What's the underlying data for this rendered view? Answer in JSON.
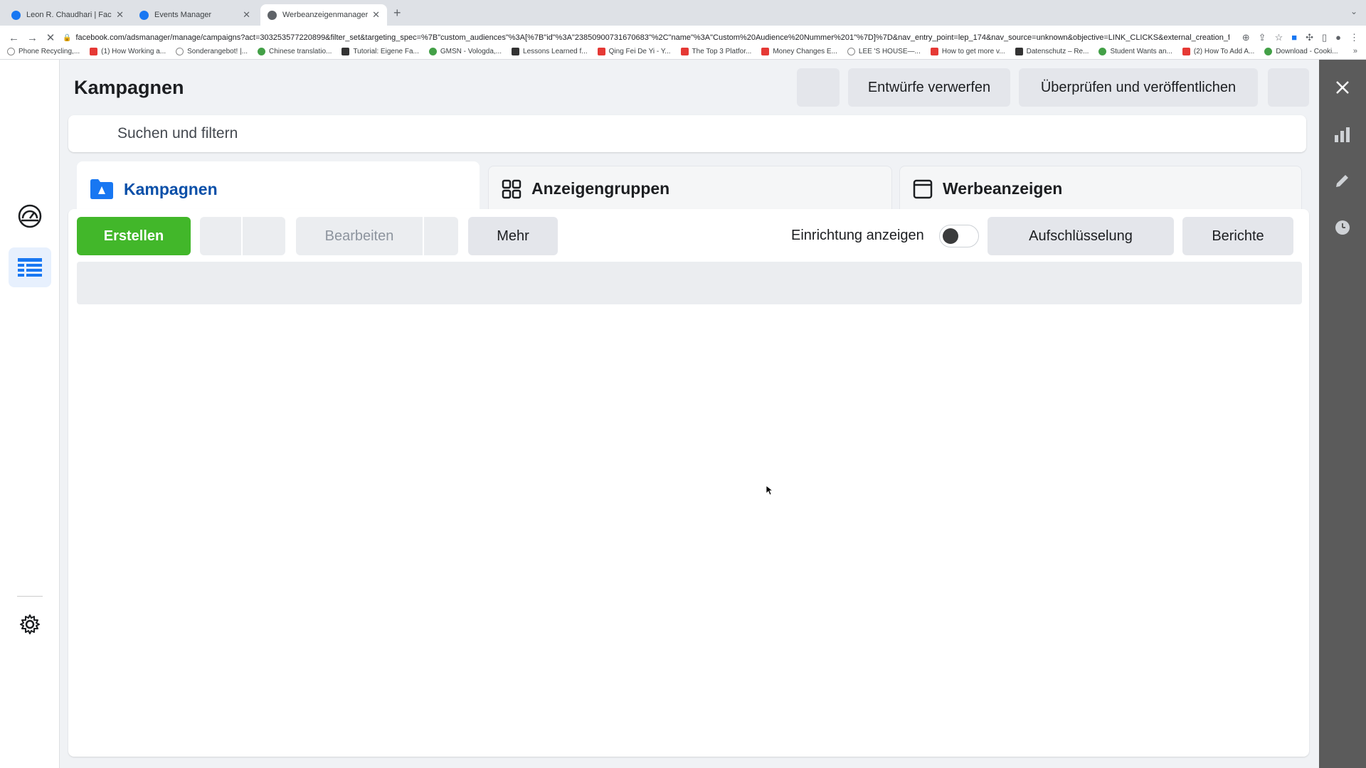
{
  "browser": {
    "tabs": [
      {
        "label": "Leon R. Chaudhari | Facebook",
        "active": false
      },
      {
        "label": "Events Manager",
        "active": false
      },
      {
        "label": "Werbeanzeigenmanager - Wer",
        "active": true
      }
    ],
    "url": "facebook.com/adsmanager/manage/campaigns?act=303253577220899&filter_set&targeting_spec=%7B\"custom_audiences\"%3A[%7B\"id\"%3A\"23850900731670683\"%2C\"name\"%3A\"Custom%20Audience%20Nummer%201\"%7D]%7D&nav_entry_point=lep_174&nav_source=unknown&objective=LINK_CLICKS&external_creation_f...",
    "bookmarks": [
      {
        "label": "Phone Recycling,...",
        "icon": "o"
      },
      {
        "label": "(1) How Working a...",
        "icon": "r"
      },
      {
        "label": "Sonderangebot! |...",
        "icon": "o"
      },
      {
        "label": "Chinese translatio...",
        "icon": "g"
      },
      {
        "label": "Tutorial: Eigene Fa...",
        "icon": "k"
      },
      {
        "label": "GMSN - Vologda,...",
        "icon": "g"
      },
      {
        "label": "Lessons Learned f...",
        "icon": "k"
      },
      {
        "label": "Qing Fei De Yi - Y...",
        "icon": "r"
      },
      {
        "label": "The Top 3 Platfor...",
        "icon": "r"
      },
      {
        "label": "Money Changes E...",
        "icon": "r"
      },
      {
        "label": "LEE 'S HOUSE—...",
        "icon": "o"
      },
      {
        "label": "How to get more v...",
        "icon": "r"
      },
      {
        "label": "Datenschutz – Re...",
        "icon": "k"
      },
      {
        "label": "Student Wants an...",
        "icon": "g"
      },
      {
        "label": "(2) How To Add A...",
        "icon": "r"
      },
      {
        "label": "Download - Cooki...",
        "icon": "g"
      }
    ]
  },
  "header": {
    "title": "Kampagnen",
    "discard_label": "Entwürfe verwerfen",
    "publish_label": "Überprüfen und veröffentlichen"
  },
  "search": {
    "placeholder": "Suchen und filtern"
  },
  "tabs": [
    {
      "label": "Kampagnen",
      "icon": "folder-icon"
    },
    {
      "label": "Anzeigengruppen",
      "icon": "grid-icon"
    },
    {
      "label": "Werbeanzeigen",
      "icon": "ad-window-icon"
    }
  ],
  "toolbar": {
    "create_label": "Erstellen",
    "edit_label": "Bearbeiten",
    "more_label": "Mehr",
    "setup_toggle_label": "Einrichtung anzeigen",
    "breakdown_label": "Aufschlüsselung",
    "reports_label": "Berichte"
  },
  "colors": {
    "accent_blue": "#0a4fa8",
    "create_green": "#42b72a",
    "right_rail": "#5b5b5b"
  }
}
